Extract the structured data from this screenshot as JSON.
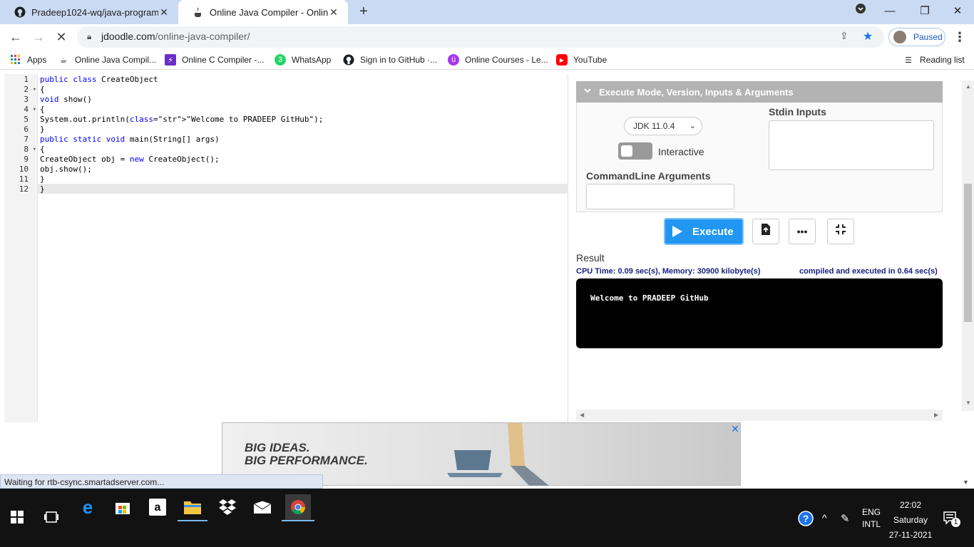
{
  "tabs": [
    {
      "title": "Pradeep1024-wq/java-program",
      "active": false
    },
    {
      "title": "Online Java Compiler - Online Java",
      "active": true
    }
  ],
  "toolbar": {
    "url_host": "jdoodle.com",
    "url_path": "/online-java-compiler/",
    "profile_label": "Paused"
  },
  "bookmarks": [
    {
      "label": "Apps",
      "icon": "apps-grid-icon"
    },
    {
      "label": "Online Java Compil...",
      "icon": "java-icon"
    },
    {
      "label": "Online C Compiler -...",
      "icon": "c-compiler-icon"
    },
    {
      "label": "WhatsApp",
      "icon": "whatsapp-icon"
    },
    {
      "label": "Sign in to GitHub ·...",
      "icon": "github-icon"
    },
    {
      "label": "Online Courses - Le...",
      "icon": "udemy-icon"
    },
    {
      "label": "YouTube",
      "icon": "youtube-icon"
    }
  ],
  "reading_list": "Reading list",
  "editor": {
    "line_numbers": [
      "1",
      "2",
      "3",
      "4",
      "5",
      "6",
      "7",
      "8",
      "9",
      "10",
      "11",
      "12"
    ],
    "folds": [
      "",
      "▾",
      "",
      "▾",
      "",
      "",
      "",
      "▾",
      "",
      "",
      "",
      ""
    ],
    "lines": [
      "public class CreateObject",
      "{",
      "void show()",
      "{",
      "System.out.println(\"Welcome to PRADEEP GitHub\");",
      "}",
      "public static void main(String[] args)",
      "{",
      "CreateObject obj = new CreateObject();",
      "obj.show();",
      "}",
      "}"
    ]
  },
  "panel": {
    "header": "Execute Mode, Version, Inputs & Arguments",
    "jdk_version": "JDK 11.0.4",
    "interactive_label": "Interactive",
    "stdin_label": "Stdin Inputs",
    "cmd_label": "CommandLine Arguments",
    "execute_label": "Execute",
    "result_label": "Result",
    "cpu_stats": "CPU Time: 0.09 sec(s), Memory: 30900 kilobyte(s)",
    "compiled_info": "compiled and executed in 0.64 sec(s)",
    "output": "Welcome to PRADEEP GitHub"
  },
  "ad": {
    "line1": "BIG IDEAS.",
    "line2": "BIG PERFORMANCE."
  },
  "status_text": "Waiting for rtb-csync.smartadserver.com...",
  "tray": {
    "lang1": "ENG",
    "lang2": "INTL",
    "time": "22:02",
    "day": "Saturday",
    "date": "27-11-2021",
    "notification_count": "1"
  },
  "colors": {
    "accent": "#2196f3",
    "tab_strip": "#cbdaf3",
    "stats_text": "#1a237e"
  }
}
